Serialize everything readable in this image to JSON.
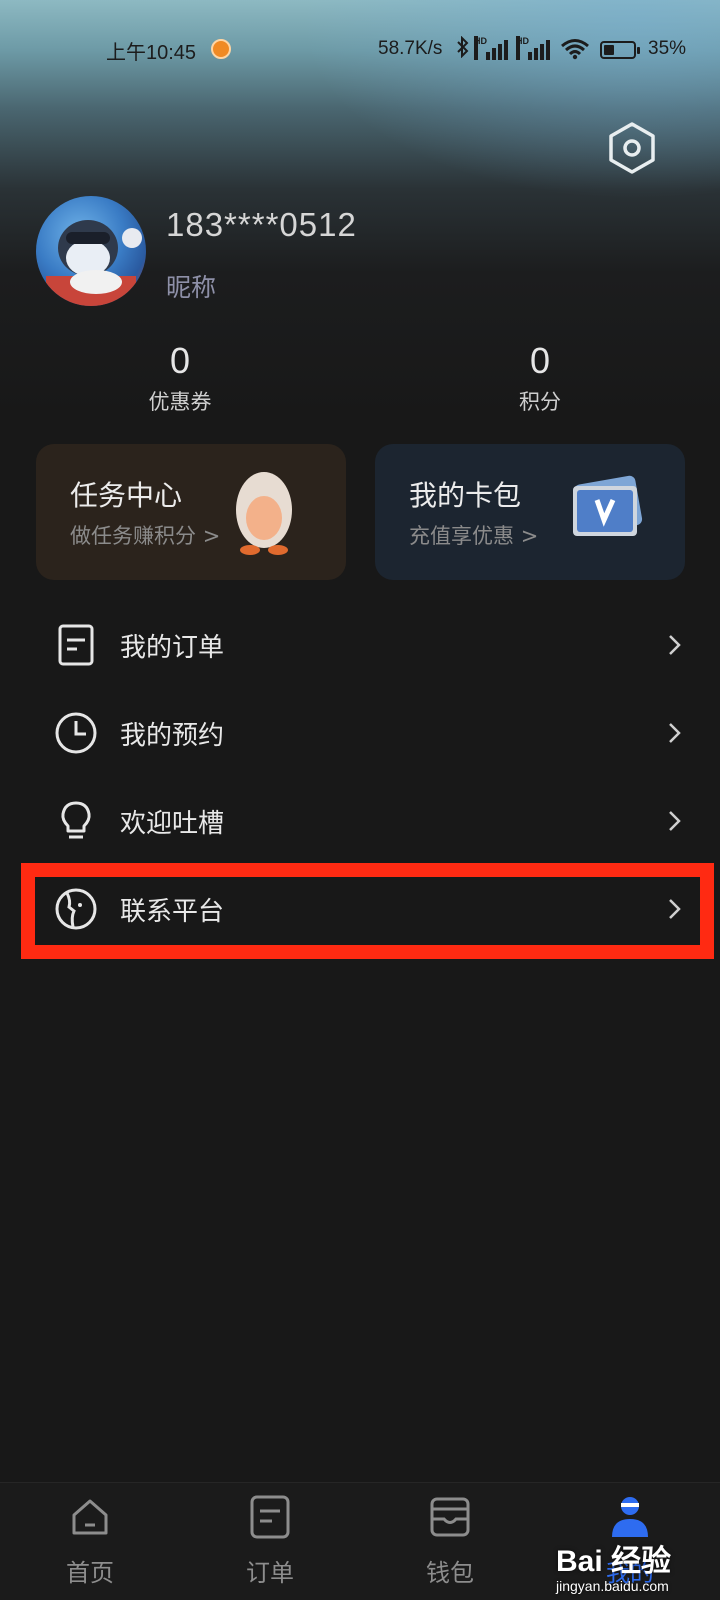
{
  "status_bar": {
    "time": "上午10:45",
    "network_speed": "58.7K/s",
    "battery_percent": "35%",
    "battery_level": 0.35,
    "icons": [
      "notification-icon",
      "bluetooth-icon",
      "hd-signal-icon",
      "hd-signal-icon",
      "wifi-icon",
      "battery-icon"
    ]
  },
  "header": {
    "settings_icon": "hexagon-settings-icon"
  },
  "profile": {
    "phone": "183****0512",
    "nickname": "昵称"
  },
  "stats": [
    {
      "value": "0",
      "label": "优惠券"
    },
    {
      "value": "0",
      "label": "积分"
    }
  ],
  "cards": {
    "task": {
      "title": "任务中心",
      "subtitle": "做任务赚积分",
      "arrow": ">"
    },
    "wallet": {
      "title": "我的卡包",
      "subtitle": "充值享优惠",
      "arrow": ">"
    }
  },
  "menu": [
    {
      "label": "我的订单",
      "icon": "order-list-icon"
    },
    {
      "label": "我的预约",
      "icon": "clock-icon"
    },
    {
      "label": "欢迎吐槽",
      "icon": "lightbulb-icon"
    },
    {
      "label": "联系平台",
      "icon": "contact-face-icon",
      "highlighted": true
    }
  ],
  "tabbar": [
    {
      "label": "首页",
      "icon": "home-icon"
    },
    {
      "label": "订单",
      "icon": "order-icon"
    },
    {
      "label": "钱包",
      "icon": "wallet-icon"
    },
    {
      "label": "我的",
      "icon": "profile-icon",
      "active": true
    }
  ],
  "watermark": {
    "main": "Bai 经验",
    "sub": "jingyan.baidu.com"
  },
  "colors": {
    "accent": "#2e6cf0",
    "highlight_box": "#ff2a12",
    "background": "#181818"
  }
}
